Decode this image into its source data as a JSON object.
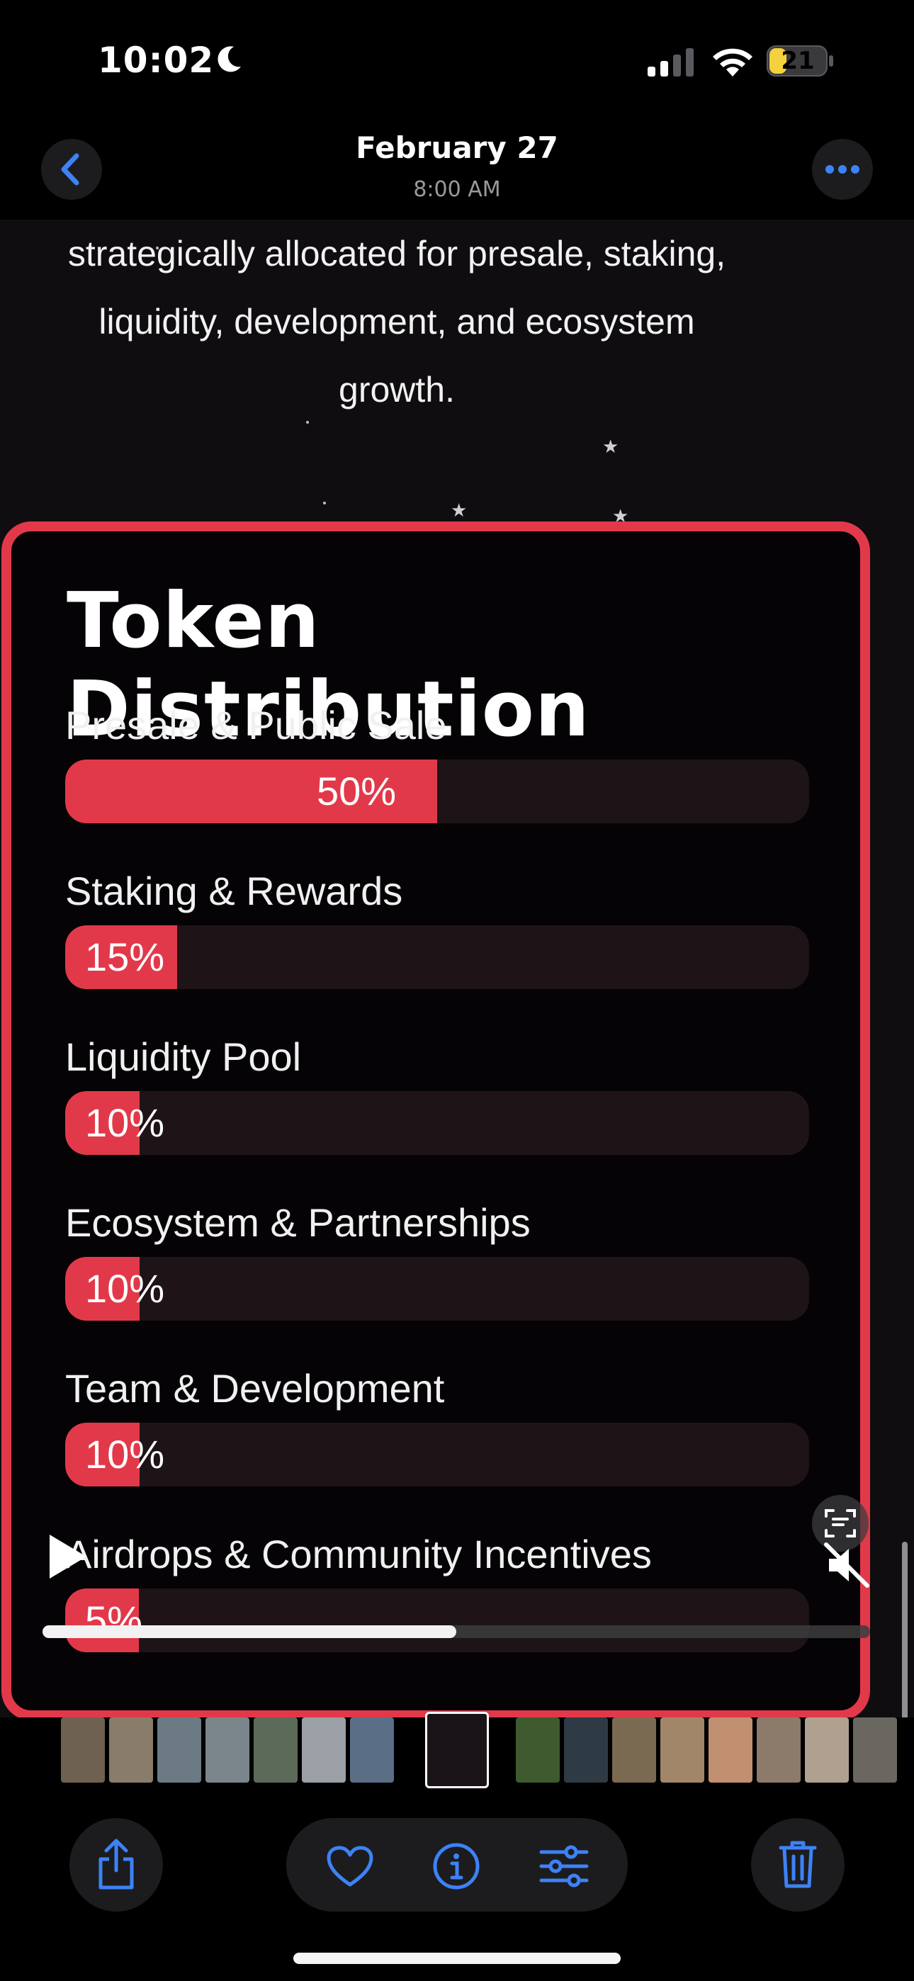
{
  "status_bar": {
    "time": "10:02",
    "battery_level": "21",
    "icons": [
      "moon-icon",
      "cellular-signal-icon",
      "wifi-icon",
      "battery-icon"
    ]
  },
  "nav": {
    "title": "February 27",
    "subtitle": "8:00 AM",
    "icons": [
      "chevron-left-icon",
      "more-icon"
    ]
  },
  "intro_lines": [
    "strategically allocated for presale, staking,",
    "liquidity, development, and ecosystem",
    "growth."
  ],
  "card": {
    "title": "Token Distribution",
    "items": [
      {
        "label": "Presale & Public Sale",
        "pct_text": "50%",
        "percent": 50
      },
      {
        "label": "Staking & Rewards",
        "pct_text": "15%",
        "percent": 15
      },
      {
        "label": "Liquidity Pool",
        "pct_text": "10%",
        "percent": 10
      },
      {
        "label": "Ecosystem & Partnerships",
        "pct_text": "10%",
        "percent": 10
      },
      {
        "label": "Team & Development",
        "pct_text": "10%",
        "percent": 10
      },
      {
        "label": "Airdrops & Community Incentives",
        "pct_text": "5%",
        "percent": 5
      }
    ]
  },
  "video": {
    "progress": 0.5,
    "icons": [
      "play-icon",
      "speaker-muted-icon",
      "live-text-icon"
    ]
  },
  "toolbar": {
    "icons": [
      "share-icon",
      "heart-icon",
      "info-icon",
      "adjust-icon",
      "trash-icon"
    ]
  },
  "colors": {
    "accent_red": "#e2394a",
    "ios_blue": "#3d82f6",
    "battery_yellow": "#f4d13d"
  }
}
